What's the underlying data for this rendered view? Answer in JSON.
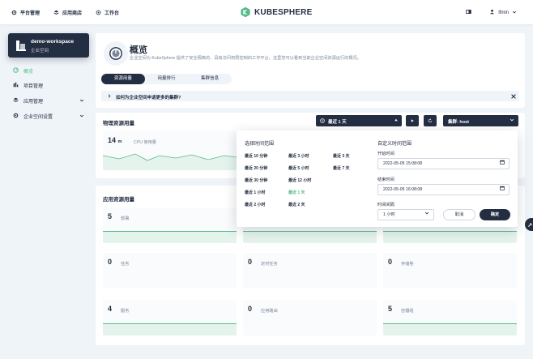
{
  "topbar": {
    "platform": "平台管理",
    "appstore": "应用商店",
    "workbench": "工作台",
    "logo": "KUBESPHERE",
    "user": "lfmin"
  },
  "sidebar": {
    "workspace_name": "demo-workspace",
    "workspace_sub": "企业空间",
    "items": [
      {
        "label": "概览",
        "icon": "dashboard-icon"
      },
      {
        "label": "项目管理",
        "icon": "bar-chart-icon"
      },
      {
        "label": "应用管理",
        "icon": "cube-icon"
      },
      {
        "label": "企业空间设置",
        "icon": "gear-icon"
      }
    ]
  },
  "header": {
    "title": "概览",
    "description": "企业空间为 KubeSphere 提供了安全隔离的、具有访问权限控制的工作平台。这里您可以看到当前企业空间资源运行的概况。",
    "tabs": [
      "资源用量",
      "用量排行",
      "集群信息"
    ],
    "faq": "如何为企业空间申请更多的集群?"
  },
  "physical": {
    "title": "物理资源用量",
    "time_select": "最近 1 天",
    "cluster_select": "集群: host",
    "cpu_value": "14",
    "cpu_unit": "m",
    "cpu_label": "CPU 使用量"
  },
  "app_resources": {
    "title": "应用资源用量",
    "items": [
      {
        "value": "5",
        "label": "部署"
      },
      {
        "value": "0",
        "label": "任务"
      },
      {
        "value": "0",
        "label": "定时任务"
      },
      {
        "value": "0",
        "label": "存储卷"
      },
      {
        "value": "4",
        "label": "服务"
      },
      {
        "value": "0",
        "label": "应用路由"
      },
      {
        "value": "5",
        "label": "容器组"
      }
    ]
  },
  "popup": {
    "select_title": "选择时间范围",
    "custom_title": "自定义时间范围",
    "ranges": [
      [
        "最近 10 分钟",
        "最近 3 小时",
        "最近 3 天"
      ],
      [
        "最近 20 分钟",
        "最近 5 小时",
        "最近 7 天"
      ],
      [
        "最近 30 分钟",
        "最近 12 小时"
      ],
      [
        "最近 1 小时",
        "最近 1 天"
      ],
      [
        "最近 2 小时",
        "最近 2 天"
      ]
    ],
    "selected_range": "最近 1 天",
    "start_label": "开始时间",
    "start_value": "2022-05-05 15:08:08",
    "end_label": "结束时间",
    "end_value": "2022-05-05 16:08:08",
    "interval_label": "时间间隔",
    "interval_value": "1 小时",
    "cancel": "取消",
    "ok": "确定"
  }
}
